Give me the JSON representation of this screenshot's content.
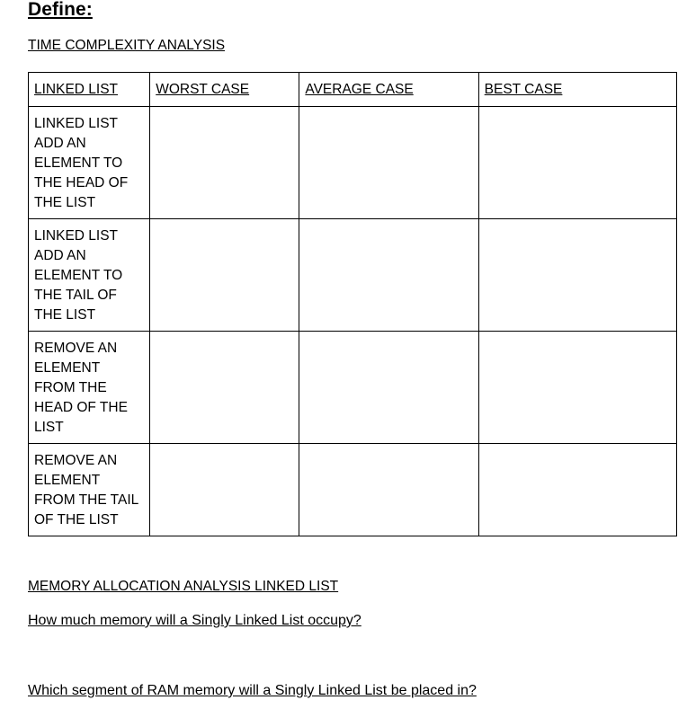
{
  "document": {
    "title": "Define:",
    "sections": {
      "time_complexity": "TIME COMPLEXITY ANALYSIS",
      "memory_allocation": "MEMORY ALLOCATION ANALYSIS LINKED LIST"
    },
    "table": {
      "headers": [
        "LINKED LIST",
        "WORST CASE",
        "AVERAGE CASE",
        "BEST CASE"
      ],
      "rows": [
        {
          "operation": "LINKED LIST ADD AN ELEMENT TO THE HEAD OF THE LIST",
          "worst": "",
          "average": "",
          "best": ""
        },
        {
          "operation": "LINKED LIST ADD AN ELEMENT TO THE TAIL OF THE LIST",
          "worst": "",
          "average": "",
          "best": ""
        },
        {
          "operation": "REMOVE AN ELEMENT FROM THE HEAD OF THE LIST",
          "worst": "",
          "average": "",
          "best": ""
        },
        {
          "operation": "REMOVE AN ELEMENT FROM THE TAIL OF THE LIST",
          "worst": "",
          "average": "",
          "best": ""
        }
      ]
    },
    "questions": [
      "How much memory will a Singly Linked List occupy?",
      "Which segment of RAM memory will a Singly Linked List be placed in?"
    ]
  }
}
